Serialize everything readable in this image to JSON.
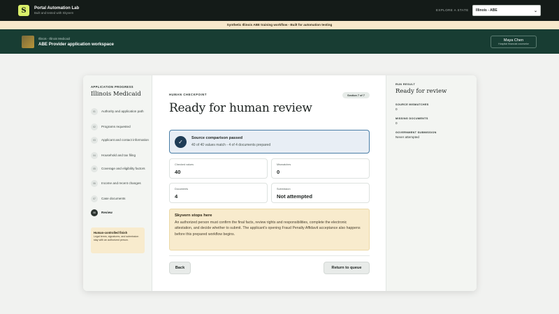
{
  "app": {
    "logo_letter": "S",
    "title": "Portal Automation Lab",
    "subtitle": "Built and tested with Skyvern",
    "explore_label": "EXPLORE A STATE",
    "state_select_value": "Illinois - ABE"
  },
  "notice": "Synthetic Illinois ABE training workflow - Built for automation testing",
  "workspace": {
    "eyebrow": "Illinois - Illinois Medicaid",
    "title": "ABE Provider application workspace",
    "user_name": "Maya Chen",
    "user_role": "Hospital financial counselor"
  },
  "progress": {
    "eyebrow": "APPLICATION PROGRESS",
    "title": "Illinois Medicaid",
    "steps": [
      {
        "num": "01",
        "label": "Authority and application path"
      },
      {
        "num": "02",
        "label": "Programs requested"
      },
      {
        "num": "03",
        "label": "Applicant and contact information"
      },
      {
        "num": "04",
        "label": "Household and tax filing"
      },
      {
        "num": "05",
        "label": "Coverage and eligibility factors"
      },
      {
        "num": "06",
        "label": "Income and recent changes"
      },
      {
        "num": "07",
        "label": "Case documents"
      },
      {
        "num": "08",
        "label": "Review"
      }
    ],
    "active_step": 7,
    "note_title": "Human-controlled finish",
    "note_text": "Legal terms, signatures, and submission stay with an authorized person."
  },
  "main": {
    "eyebrow": "HUMAN CHECKPOINT",
    "section_pill": "Section 7 of 7",
    "title": "Ready for human review",
    "pass_title": "Source comparison passed",
    "pass_sub": "40 of 40 values match - 4 of 4 documents prepared",
    "stats": [
      {
        "key": "Checked values",
        "value": "40"
      },
      {
        "key": "Mismatches",
        "value": "0"
      },
      {
        "key": "Documents",
        "value": "4"
      },
      {
        "key": "Submission",
        "value": "Not attempted"
      }
    ],
    "warn_title": "Skyvern stops here",
    "warn_text": "An authorized person must confirm the final facts, review rights and responsibilities, complete the electronic attestation, and decide whether to submit. The applicant's opening Fraud Penalty Affidavit acceptance also happens before this prepared workflow begins.",
    "back_label": "Back",
    "queue_label": "Return to queue"
  },
  "result": {
    "eyebrow": "RUN RESULT",
    "title": "Ready for review",
    "mismatch_label": "SOURCE MISMATCHES",
    "mismatch_value": "0",
    "missing_label": "MISSING DOCUMENTS",
    "missing_value": "0",
    "gov_label": "GOVERNMENT SUBMISSION",
    "gov_value": "Never attempted"
  },
  "colors": {
    "topbar": "#141b18",
    "accent": "#d9ef6a",
    "workspace_header": "#183d33",
    "notice_bg": "#f7e8cb",
    "pass_border": "#4a7ea6"
  },
  "icons": {
    "pass": "check-circle-icon",
    "select": "chevron-down-icon"
  }
}
